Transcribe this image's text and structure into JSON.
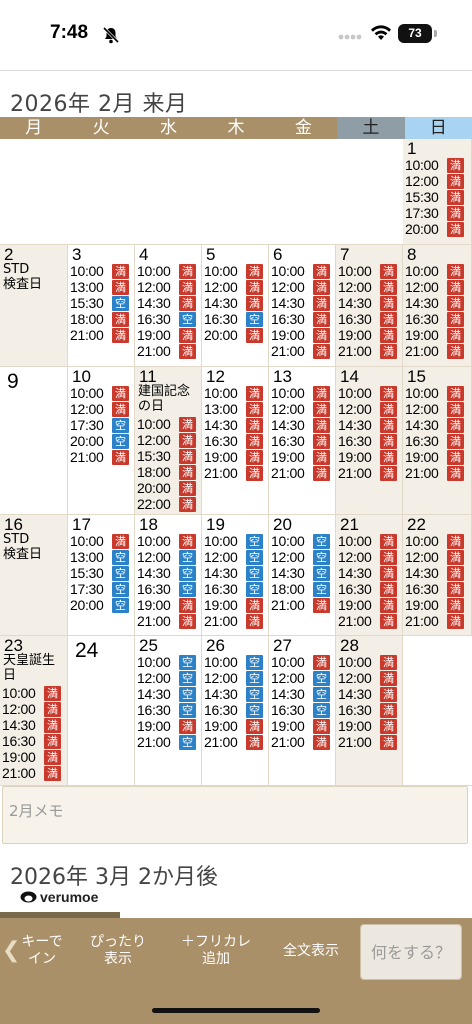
{
  "status_bar": {
    "time": "7:48",
    "battery": "73"
  },
  "calendar": {
    "title": "2026年 2月 来月",
    "weekdays": [
      "月",
      "火",
      "水",
      "木",
      "金",
      "土",
      "日"
    ],
    "legend": {
      "full": "満",
      "open": "空"
    },
    "weeks": [
      [
        null,
        null,
        null,
        null,
        null,
        null,
        {
          "day": "1",
          "slots": [
            [
              "10:00",
              "満"
            ],
            [
              "12:00",
              "満"
            ],
            [
              "15:30",
              "満"
            ],
            [
              "17:30",
              "満"
            ],
            [
              "20:00",
              "満"
            ]
          ]
        }
      ],
      [
        {
          "day": "2",
          "note": [
            "STD",
            "検査日"
          ],
          "slots": []
        },
        {
          "day": "3",
          "slots": [
            [
              "10:00",
              "満"
            ],
            [
              "13:00",
              "満"
            ],
            [
              "15:30",
              "空"
            ],
            [
              "18:00",
              "満"
            ],
            [
              "21:00",
              "満"
            ]
          ]
        },
        {
          "day": "4",
          "slots": [
            [
              "10:00",
              "満"
            ],
            [
              "12:00",
              "満"
            ],
            [
              "14:30",
              "満"
            ],
            [
              "16:30",
              "空"
            ],
            [
              "19:00",
              "満"
            ],
            [
              "21:00",
              "満"
            ]
          ]
        },
        {
          "day": "5",
          "slots": [
            [
              "10:00",
              "満"
            ],
            [
              "12:00",
              "満"
            ],
            [
              "14:30",
              "満"
            ],
            [
              "16:30",
              "空"
            ],
            [
              "20:00",
              "満"
            ]
          ]
        },
        {
          "day": "6",
          "slots": [
            [
              "10:00",
              "満"
            ],
            [
              "12:00",
              "満"
            ],
            [
              "14:30",
              "満"
            ],
            [
              "16:30",
              "満"
            ],
            [
              "19:00",
              "満"
            ],
            [
              "21:00",
              "満"
            ]
          ]
        },
        {
          "day": "7",
          "slots": [
            [
              "10:00",
              "満"
            ],
            [
              "12:00",
              "満"
            ],
            [
              "14:30",
              "満"
            ],
            [
              "16:30",
              "満"
            ],
            [
              "19:00",
              "満"
            ],
            [
              "21:00",
              "満"
            ]
          ]
        },
        {
          "day": "8",
          "slots": [
            [
              "10:00",
              "満"
            ],
            [
              "12:00",
              "満"
            ],
            [
              "14:30",
              "満"
            ],
            [
              "16:30",
              "満"
            ],
            [
              "19:00",
              "満"
            ],
            [
              "21:00",
              "満"
            ]
          ]
        }
      ],
      [
        {
          "day": "9",
          "big": true,
          "slots": []
        },
        {
          "day": "10",
          "slots": [
            [
              "10:00",
              "満"
            ],
            [
              "12:00",
              "満"
            ],
            [
              "17:30",
              "空"
            ],
            [
              "20:00",
              "空"
            ],
            [
              "21:00",
              "満"
            ]
          ]
        },
        {
          "day": "11",
          "note": [
            "建国記念",
            "の日"
          ],
          "slots": [
            [
              "10:00",
              "満"
            ],
            [
              "12:00",
              "満"
            ],
            [
              "15:30",
              "満"
            ],
            [
              "18:00",
              "満"
            ],
            [
              "20:00",
              "満"
            ],
            [
              "22:00",
              "満"
            ]
          ]
        },
        {
          "day": "12",
          "slots": [
            [
              "10:00",
              "満"
            ],
            [
              "13:00",
              "満"
            ],
            [
              "14:30",
              "満"
            ],
            [
              "16:30",
              "満"
            ],
            [
              "19:00",
              "満"
            ],
            [
              "21:00",
              "満"
            ]
          ]
        },
        {
          "day": "13",
          "slots": [
            [
              "10:00",
              "満"
            ],
            [
              "12:00",
              "満"
            ],
            [
              "14:30",
              "満"
            ],
            [
              "16:30",
              "満"
            ],
            [
              "19:00",
              "満"
            ],
            [
              "21:00",
              "満"
            ]
          ]
        },
        {
          "day": "14",
          "slots": [
            [
              "10:00",
              "満"
            ],
            [
              "12:00",
              "満"
            ],
            [
              "14:30",
              "満"
            ],
            [
              "16:30",
              "満"
            ],
            [
              "19:00",
              "満"
            ],
            [
              "21:00",
              "満"
            ]
          ]
        },
        {
          "day": "15",
          "slots": [
            [
              "10:00",
              "満"
            ],
            [
              "12:00",
              "満"
            ],
            [
              "14:30",
              "満"
            ],
            [
              "16:30",
              "満"
            ],
            [
              "19:00",
              "満"
            ],
            [
              "21:00",
              "満"
            ]
          ]
        }
      ],
      [
        {
          "day": "16",
          "note": [
            "STD",
            "検査日"
          ],
          "slots": []
        },
        {
          "day": "17",
          "slots": [
            [
              "10:00",
              "満"
            ],
            [
              "13:00",
              "空"
            ],
            [
              "15:30",
              "空"
            ],
            [
              "17:30",
              "空"
            ],
            [
              "20:00",
              "空"
            ]
          ]
        },
        {
          "day": "18",
          "slots": [
            [
              "10:00",
              "満"
            ],
            [
              "12:00",
              "空"
            ],
            [
              "14:30",
              "空"
            ],
            [
              "16:30",
              "空"
            ],
            [
              "19:00",
              "満"
            ],
            [
              "21:00",
              "満"
            ]
          ]
        },
        {
          "day": "19",
          "slots": [
            [
              "10:00",
              "空"
            ],
            [
              "12:00",
              "空"
            ],
            [
              "14:30",
              "空"
            ],
            [
              "16:30",
              "空"
            ],
            [
              "19:00",
              "満"
            ],
            [
              "21:00",
              "満"
            ]
          ]
        },
        {
          "day": "20",
          "slots": [
            [
              "10:00",
              "空"
            ],
            [
              "12:00",
              "空"
            ],
            [
              "14:30",
              "空"
            ],
            [
              "18:00",
              "空"
            ],
            [
              "21:00",
              "満"
            ]
          ]
        },
        {
          "day": "21",
          "slots": [
            [
              "10:00",
              "満"
            ],
            [
              "12:00",
              "満"
            ],
            [
              "14:30",
              "満"
            ],
            [
              "16:30",
              "満"
            ],
            [
              "19:00",
              "満"
            ],
            [
              "21:00",
              "満"
            ]
          ]
        },
        {
          "day": "22",
          "slots": [
            [
              "10:00",
              "満"
            ],
            [
              "12:00",
              "満"
            ],
            [
              "14:30",
              "満"
            ],
            [
              "16:30",
              "満"
            ],
            [
              "19:00",
              "満"
            ],
            [
              "21:00",
              "満"
            ]
          ]
        }
      ],
      [
        {
          "day": "23",
          "note": [
            "天皇誕生",
            "日"
          ],
          "slots": [
            [
              "10:00",
              "満"
            ],
            [
              "12:00",
              "満"
            ],
            [
              "14:30",
              "満"
            ],
            [
              "16:30",
              "満"
            ],
            [
              "19:00",
              "満"
            ],
            [
              "21:00",
              "満"
            ]
          ]
        },
        {
          "day": "24",
          "big": true,
          "slots": []
        },
        {
          "day": "25",
          "slots": [
            [
              "10:00",
              "空"
            ],
            [
              "12:00",
              "空"
            ],
            [
              "14:30",
              "空"
            ],
            [
              "16:30",
              "空"
            ],
            [
              "19:00",
              "満"
            ],
            [
              "21:00",
              "空"
            ]
          ]
        },
        {
          "day": "26",
          "slots": [
            [
              "10:00",
              "空"
            ],
            [
              "12:00",
              "空"
            ],
            [
              "14:30",
              "空"
            ],
            [
              "16:30",
              "空"
            ],
            [
              "19:00",
              "満"
            ],
            [
              "21:00",
              "満"
            ]
          ]
        },
        {
          "day": "27",
          "slots": [
            [
              "10:00",
              "満"
            ],
            [
              "12:00",
              "空"
            ],
            [
              "14:30",
              "空"
            ],
            [
              "16:30",
              "空"
            ],
            [
              "19:00",
              "満"
            ],
            [
              "21:00",
              "満"
            ]
          ]
        },
        {
          "day": "28",
          "slots": [
            [
              "10:00",
              "満"
            ],
            [
              "12:00",
              "満"
            ],
            [
              "14:30",
              "満"
            ],
            [
              "16:30",
              "満"
            ],
            [
              "19:00",
              "満"
            ],
            [
              "21:00",
              "満"
            ]
          ]
        },
        null
      ]
    ]
  },
  "memo": {
    "label": "2月メモ"
  },
  "next_month": {
    "title": "2026年 3月 2か月後"
  },
  "logo": {
    "text": "verumoe"
  },
  "bottom_bar": {
    "buttons": [
      {
        "id": "login",
        "label": "キーで\nイン"
      },
      {
        "id": "fit",
        "label": "ぴったり\n表示"
      },
      {
        "id": "add",
        "label": "＋フリカレ\n追加"
      },
      {
        "id": "fulltext",
        "label": "全文表示"
      }
    ],
    "action_label": "何をする？"
  },
  "colors": {
    "full": "#c93a2c",
    "open": "#2c82c9",
    "brand": "#a99068"
  }
}
